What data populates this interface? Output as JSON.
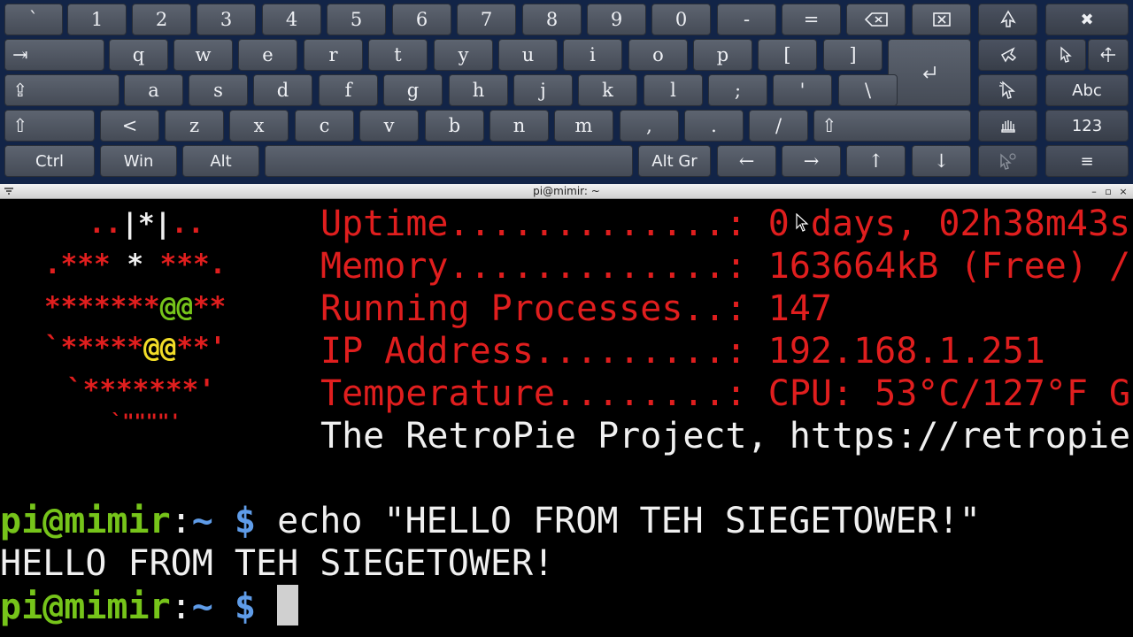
{
  "keyboard": {
    "row1": [
      "`",
      "1",
      "2",
      "3",
      "4",
      "5",
      "6",
      "7",
      "8",
      "9",
      "0",
      "-",
      "="
    ],
    "row2": [
      "q",
      "w",
      "e",
      "r",
      "t",
      "y",
      "u",
      "i",
      "o",
      "p",
      "[",
      "]"
    ],
    "row3": [
      "a",
      "s",
      "d",
      "f",
      "g",
      "h",
      "j",
      "k",
      "l",
      ";",
      "'",
      "\\"
    ],
    "row4": [
      "<",
      "z",
      "x",
      "c",
      "v",
      "b",
      "n",
      "m",
      ",",
      ".",
      "/"
    ],
    "tab_label": "⇥",
    "caps_label": "⇪",
    "shift_left_label": "⇧",
    "shift_right_label": "⇧",
    "ctrl_label": "Ctrl",
    "win_label": "Win",
    "alt_label": "Alt",
    "altgr_label": "Alt Gr",
    "arrow_left": "←",
    "arrow_right": "→",
    "arrow_up": "↑",
    "arrow_down": "↓",
    "abc_label": "Abc",
    "num_label": "123",
    "menu_label": "≡",
    "close_label": "✖",
    "backspace_icon": "backspace-icon",
    "delete_icon": "delete-icon",
    "enter_icon": "enter-icon"
  },
  "window": {
    "title": "pi@mimir: ~",
    "minimize": "–",
    "maximize": "▫",
    "close": "×"
  },
  "terminal": {
    "logo": {
      "l1": "..|*|..",
      "l2a": ".***",
      "l2b": " * ",
      "l2c": "***.",
      "l3a": "*******",
      "l3b": "@@",
      "l3c": "**",
      "l4a": "`",
      "l4b": "*****",
      "l4c": "@@",
      "l4d": "**'",
      "l5": "`*******'",
      "l6": "`\"\"\"\"'"
    },
    "info": {
      "uptime_label": "Uptime.............: ",
      "uptime_value": "0 days, 02h38m43s",
      "memory_label": "Memory.............: ",
      "memory_value": "163664kB (Free) /",
      "processes_label": "Running Processes..: ",
      "processes_value": "147",
      "ip_label": "IP Address.........: ",
      "ip_value": "192.168.1.251",
      "temp_label": "Temperature........: ",
      "temp_value": "CPU: 53°C/127°F G",
      "project_line": "The RetroPie Project, https://retropie"
    },
    "prompt_user": "pi@mimir",
    "prompt_sep": ":",
    "prompt_path": "~",
    "prompt_dollar": " $ ",
    "command": "echo \"HELLO FROM TEH SIEGETOWER!\"",
    "output": "HELLO FROM TEH SIEGETOWER!"
  },
  "colors": {
    "keyboard_bg": "#122447",
    "key_face": "#52596a",
    "info_red": "#e01e1e",
    "prompt_green": "#76c41a",
    "prompt_blue": "#5f9ce8",
    "logo_yellow": "#f2dd28"
  }
}
